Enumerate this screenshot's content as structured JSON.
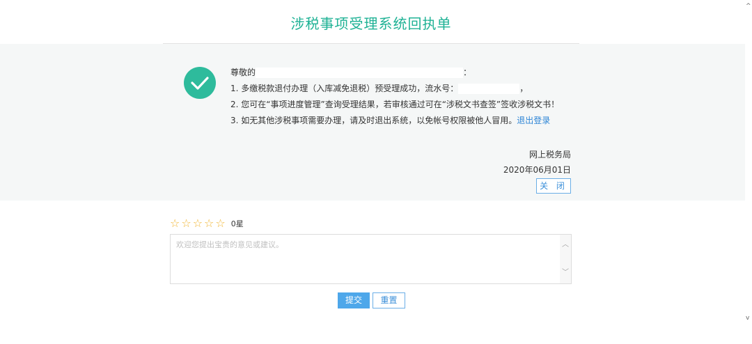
{
  "page": {
    "title": "涉税事项受理系统回执单"
  },
  "receipt": {
    "greeting": "尊敬的",
    "greeting_colon": "：",
    "line1_prefix": "1. 多缴税款退付办理（入库减免退税）预受理成功，流水号：",
    "line1_suffix": "，",
    "line2": "2. 您可在“事项进度管理”查询受理结果，若审核通过可在“涉税文书查签”签收涉税文书！",
    "line3_text": "3. 如无其他涉税事项需要办理，请及时退出系统，以免帐号权限被他人冒用。",
    "logout_link": "退出登录",
    "issuer": "网上税务局",
    "date": "2020年06月01日",
    "close_button": "关 闭"
  },
  "rating": {
    "stars_total": 5,
    "stars_value": 0,
    "star_glyph": "☆",
    "label": "0星"
  },
  "feedback": {
    "placeholder": "欢迎您提出宝贵的意见或建议。",
    "value": ""
  },
  "actions": {
    "submit": "提交",
    "reset": "重置"
  },
  "colors": {
    "title": "#1fb295",
    "check_circle": "#2ebb9c",
    "link": "#2f86d6",
    "primary_button": "#4ea7ea",
    "star": "#f0b430"
  }
}
